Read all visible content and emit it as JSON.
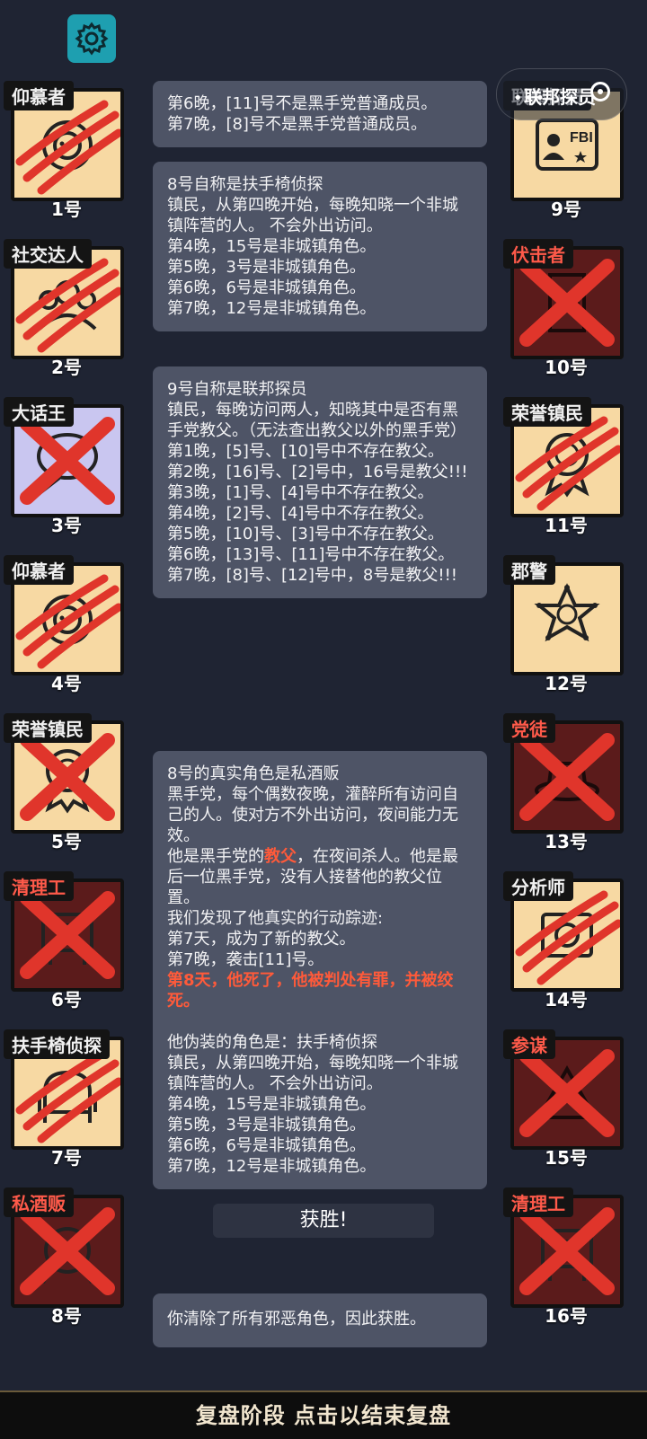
{
  "header": {
    "capsule_text": "联邦探员"
  },
  "players_left": [
    {
      "role": "仰慕者",
      "number": "1号",
      "card": "light",
      "mark": "claw",
      "icon": "lion-icon",
      "tag_color": "white"
    },
    {
      "role": "社交达人",
      "number": "2号",
      "card": "light",
      "mark": "claw",
      "icon": "people-icon",
      "tag_color": "white"
    },
    {
      "role": "大话王",
      "number": "3号",
      "card": "purple",
      "mark": "cross",
      "icon": "speech-bubble-icon",
      "tag_color": "white"
    },
    {
      "role": "仰慕者",
      "number": "4号",
      "card": "light",
      "mark": "claw",
      "icon": "lion-icon",
      "tag_color": "white"
    },
    {
      "role": "荣誉镇民",
      "number": "5号",
      "card": "light",
      "mark": "cross",
      "icon": "medal-icon",
      "tag_color": "white"
    },
    {
      "role": "清理工",
      "number": "6号",
      "card": "dark",
      "mark": "cross",
      "icon": "cleaner-icon",
      "tag_color": "red"
    },
    {
      "role": "扶手椅侦探",
      "number": "7号",
      "card": "light",
      "mark": "claw",
      "icon": "armchair-icon",
      "tag_color": "white"
    },
    {
      "role": "私酒贩",
      "number": "8号",
      "card": "dark",
      "mark": "cross",
      "icon": "bootlegger-icon",
      "tag_color": "red"
    }
  ],
  "players_right": [
    {
      "role": "联邦探员",
      "number": "9号",
      "card": "light",
      "mark": "none",
      "icon": "fbi-badge-icon",
      "tag_color": "white"
    },
    {
      "role": "伏击者",
      "number": "10号",
      "card": "dark",
      "mark": "cross",
      "icon": "door-icon",
      "tag_color": "red"
    },
    {
      "role": "荣誉镇民",
      "number": "11号",
      "card": "light",
      "mark": "claw",
      "icon": "medal-icon",
      "tag_color": "white"
    },
    {
      "role": "郡警",
      "number": "12号",
      "card": "light",
      "mark": "none",
      "icon": "sheriff-star-icon",
      "tag_color": "white"
    },
    {
      "role": "党徒",
      "number": "13号",
      "card": "dark",
      "mark": "cross",
      "icon": "hat-icon",
      "tag_color": "red"
    },
    {
      "role": "分析师",
      "number": "14号",
      "card": "light",
      "mark": "claw",
      "icon": "analyst-icon",
      "tag_color": "white"
    },
    {
      "role": "参谋",
      "number": "15号",
      "card": "dark",
      "mark": "cross",
      "icon": "tactician-icon",
      "tag_color": "red"
    },
    {
      "role": "清理工",
      "number": "16号",
      "card": "dark",
      "mark": "cross",
      "icon": "cleaner-icon",
      "tag_color": "red"
    }
  ],
  "logs": [
    {
      "lines": [
        "第6晚，[11]号不是黑手党普通成员。",
        "第7晚，[8]号不是黑手党普通成员。"
      ]
    },
    {
      "lines": [
        "8号自称是扶手椅侦探",
        "镇民，从第四晚开始，每晚知晓一个非城镇阵营的人。 不会外出访问。",
        "第4晚，15号是非城镇角色。",
        "第5晚，3号是非城镇角色。",
        "第6晚，6号是非城镇角色。",
        "第7晚，12号是非城镇角色。"
      ]
    },
    {
      "lines": [
        "9号自称是联邦探员",
        "镇民，每晚访问两人，知晓其中是否有黑手党教父。（无法查出教父以外的黑手党）",
        "第1晚，[5]号、[10]号中不存在教父。",
        "第2晚，[16]号、[2]号中，16号是教父!!!",
        "第3晚，[1]号、[4]号中不存在教父。",
        "第4晚，[2]号、[4]号中不存在教父。",
        "第5晚，[10]号、[3]号中不存在教父。",
        "第6晚，[13]号、[11]号中不存在教父。",
        "第7晚，[8]号、[12]号中，8号是教父!!!"
      ]
    }
  ],
  "reveal": {
    "title": "8号的真实角色是私酒贩",
    "desc": "黑手党，每个偶数夜晚，灌醉所有访问自己的人。使对方不外出访问，夜间能力无效。",
    "godfather_pre": "他是黑手党的",
    "godfather_word": "教父",
    "godfather_post": "，在夜间杀人。他是最后一位黑手党，没有人接替他的教父位置。",
    "trace_header": "我们发现了他真实的行动踪迹:",
    "trace_1": "第7天，成为了新的教父。",
    "trace_2": "第7晚，袭击[11]号。",
    "death": "第8天，他死了，他被判处有罪，并被绞死。",
    "fake_header": "他伪装的角色是：扶手椅侦探",
    "fake_desc": "镇民，从第四晚开始，每晚知晓一个非城镇阵营的人。 不会外出访问。",
    "fake_1": "第4晚，15号是非城镇角色。",
    "fake_2": "第5晚，3号是非城镇角色。",
    "fake_3": "第6晚，6号是非城镇角色。",
    "fake_4": "第7晚，12号是非城镇角色。"
  },
  "victory": {
    "label": "获胜!",
    "message": "你清除了所有邪恶角色，因此获胜。"
  },
  "bottom_bar": {
    "label": "复盘阶段 点击以结束复盘"
  },
  "colors": {
    "background": "#1f2433",
    "card_light": "#f7d9a3",
    "card_dark": "#5b1b1b",
    "mark_red": "#e0352b",
    "highlight": "#ff5a3a",
    "gear": "#1e9fb0"
  }
}
